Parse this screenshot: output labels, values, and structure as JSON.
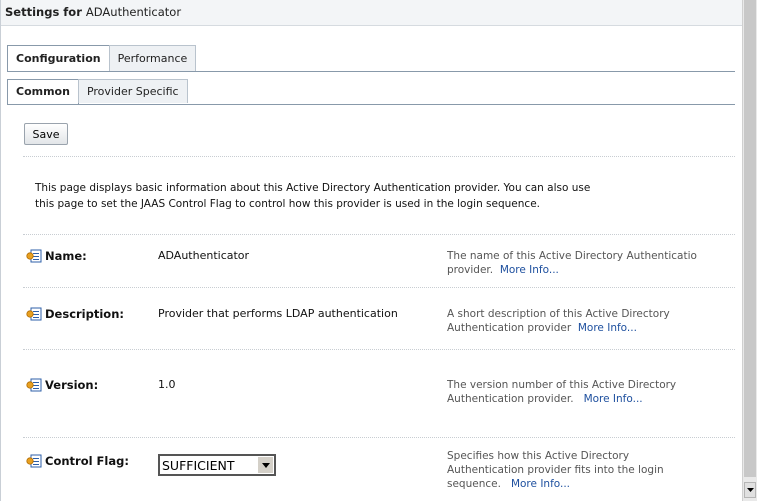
{
  "header": {
    "prefix": "Settings for",
    "name": "ADAuthenticator"
  },
  "tabs_primary": [
    {
      "label": "Configuration",
      "active": true
    },
    {
      "label": "Performance",
      "active": false
    }
  ],
  "tabs_secondary": [
    {
      "label": "Common",
      "active": true
    },
    {
      "label": "Provider Specific",
      "active": false
    }
  ],
  "toolbar": {
    "save_label": "Save"
  },
  "intro": {
    "line1": "This page displays basic information about this Active Directory Authentication provider.  You can also use",
    "line2": "this page to set the JAAS Control Flag to control how this provider is used in the login sequence."
  },
  "fields": {
    "name": {
      "label": "Name:",
      "value": "ADAuthenticator",
      "help1": "The name of this Active Directory Authenticatio",
      "help2": "provider.",
      "more": "More Info..."
    },
    "description": {
      "label": "Description:",
      "value": "Provider that performs LDAP authentication",
      "help1": "A short description of this Active Directory",
      "help2": "Authentication provider",
      "more": "More Info..."
    },
    "version": {
      "label": "Version:",
      "value": "1.0",
      "help1": "The version number of this Active Directory",
      "help2": "Authentication provider.",
      "more": "More Info..."
    },
    "control_flag": {
      "label": "Control Flag:",
      "value": "SUFFICIENT",
      "help1": "Specifies how this Active Directory",
      "help2": "Authentication provider fits into the login",
      "help3": "sequence.",
      "more": "More Info..."
    }
  },
  "icons": {
    "field_icon": "field-info-icon",
    "dropdown": "chevron-down-icon",
    "scroll_down": "scroll-down-arrow-icon"
  },
  "colors": {
    "link": "#1d4f9e",
    "tab_border": "#8899aa",
    "help_text": "#555555"
  }
}
